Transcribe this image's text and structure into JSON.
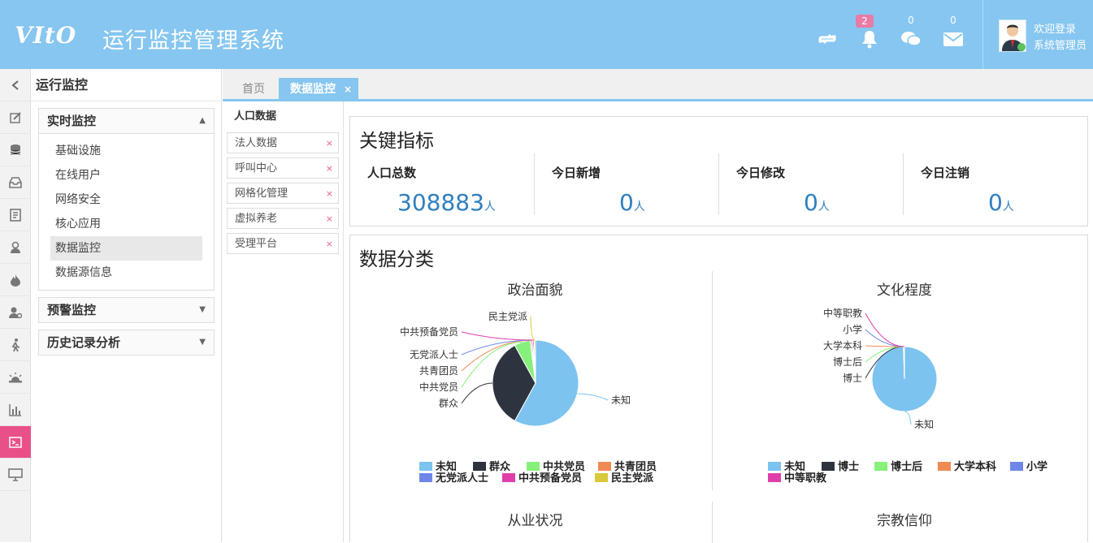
{
  "header": {
    "logo": "VItO",
    "title": "运行监控管理系统",
    "bell_count": "2",
    "chat_count": "0",
    "mail_count": "0",
    "welcome": "欢迎登录",
    "user": "系统管理员"
  },
  "colors": {
    "header_bg": "#86c6f0",
    "active_icon": "#e9508a",
    "kpi_value": "#2f7fc0"
  },
  "iconbar": [
    "chevron-left-icon",
    "edit-icon",
    "database-icon",
    "inbox-icon",
    "document-icon",
    "user-lock-icon",
    "fire-icon",
    "user-settings-icon",
    "walk-icon",
    "alarm-icon",
    "bar-chart-icon",
    "terminal-icon",
    "monitor-icon"
  ],
  "leftnav": {
    "title": "运行监控",
    "panels": [
      {
        "label": "实时监控",
        "items": [
          "基础设施",
          "在线用户",
          "网络安全",
          "核心应用",
          "数据监控",
          "数据源信息"
        ],
        "selected": "数据监控"
      },
      {
        "label": "预警监控"
      },
      {
        "label": "历史记录分析"
      }
    ]
  },
  "tabs": {
    "home": "首页",
    "active": "数据监控",
    "close": "×"
  },
  "sublist": {
    "header": "人口数据",
    "items": [
      "法人数据",
      "呼叫中心",
      "网格化管理",
      "虚拟养老",
      "受理平台"
    ],
    "close": "×"
  },
  "kpi": {
    "title": "关键指标",
    "items": [
      {
        "label": "人口总数",
        "value": "308883",
        "unit": "人"
      },
      {
        "label": "今日新增",
        "value": "0",
        "unit": "人"
      },
      {
        "label": "今日修改",
        "value": "0",
        "unit": "人"
      },
      {
        "label": "今日注销",
        "value": "0",
        "unit": "人"
      }
    ]
  },
  "data_section": {
    "title": "数据分类",
    "bottom_titles": [
      "从业状况",
      "宗教信仰"
    ]
  },
  "chart_data": [
    {
      "type": "pie",
      "title": "政治面貌",
      "categories": [
        "未知",
        "群众",
        "中共党员",
        "共青团员",
        "无党派人士",
        "中共预备党员",
        "民主党派"
      ],
      "values": [
        58,
        34,
        6,
        0.5,
        0.5,
        0.5,
        0.5
      ],
      "colors": [
        "#7cc3ef",
        "#2d3440",
        "#86f07a",
        "#ef8a54",
        "#6f86e8",
        "#e03faa",
        "#d7c93a"
      ],
      "legend_position": "bottom"
    },
    {
      "type": "pie",
      "title": "文化程度",
      "categories": [
        "未知",
        "博士",
        "博士后",
        "大学本科",
        "小学",
        "中等职教"
      ],
      "values": [
        99.5,
        0.1,
        0.1,
        0.1,
        0.1,
        0.1
      ],
      "colors": [
        "#7cc3ef",
        "#2d3440",
        "#86f07a",
        "#ef8a54",
        "#6f86e8",
        "#e03faa"
      ],
      "legend_position": "bottom"
    }
  ]
}
